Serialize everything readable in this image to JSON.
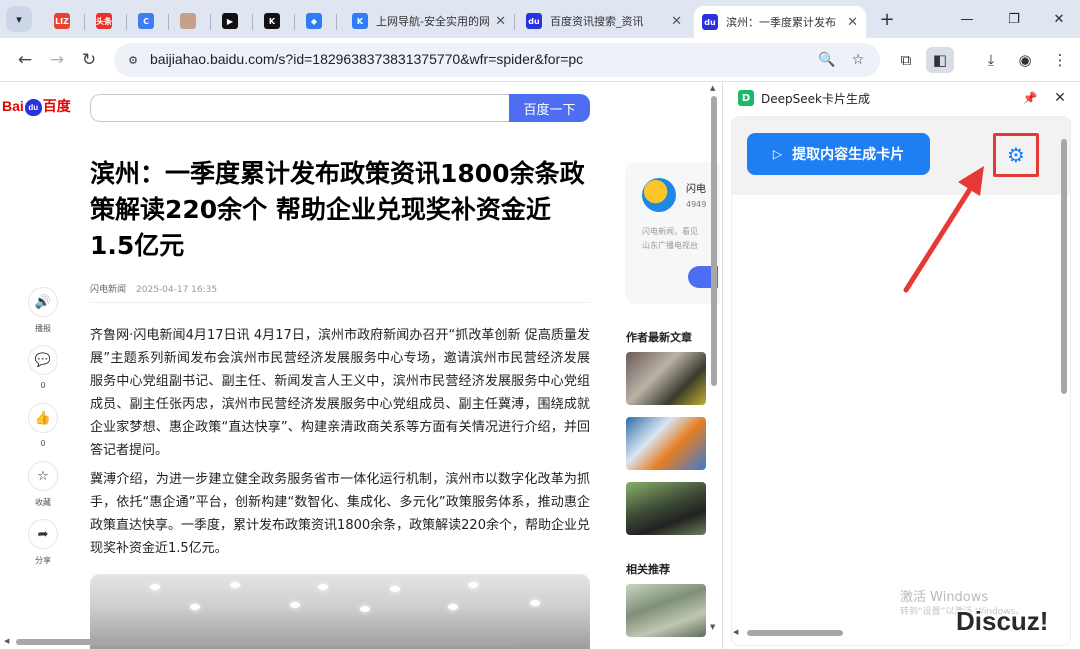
{
  "browser": {
    "tabs": [
      {
        "label": "",
        "favicon_text": "LIZ",
        "favicon_color": "#e94235"
      },
      {
        "label": "",
        "favicon_text": "头条",
        "favicon_color": "#e8322c"
      },
      {
        "label": "",
        "favicon_text": "C",
        "favicon_color": "#3d7cf4"
      },
      {
        "label": "",
        "favicon_text": "",
        "favicon_color": "#c7a08c"
      },
      {
        "label": "",
        "favicon_text": "▶",
        "favicon_color": "#111111"
      },
      {
        "label": "",
        "favicon_text": "K",
        "favicon_color": "#111111"
      },
      {
        "label": "",
        "favicon_text": "◆",
        "favicon_color": "#2f7df6"
      },
      {
        "label": "上网导航-安全实用的网",
        "favicon_text": "K",
        "favicon_color": "#2f7df6"
      },
      {
        "label": "百度资讯搜索_资讯",
        "favicon_text": "du",
        "favicon_color": "#2932e1"
      },
      {
        "label": "滨州：一季度累计发布",
        "favicon_text": "du",
        "favicon_color": "#2932e1"
      }
    ],
    "url": "baijiahao.baidu.com/s?id=1829638373831375770&wfr=spider&for=pc",
    "window_controls": {
      "minimize": "—",
      "restore": "❐",
      "close": "✕"
    }
  },
  "baidu": {
    "logo_left": "Bai",
    "logo_paw": "du",
    "logo_right": "百度",
    "search_button": "百度一下"
  },
  "article": {
    "title": "滨州：一季度累计发布政策资讯1800余条政策解读220余个 帮助企业兑现奖补资金近1.5亿元",
    "source": "闪电新闻",
    "date": "2025-04-17 16:35",
    "paragraphs": [
      "齐鲁网·闪电新闻4月17日讯 4月17日，滨州市政府新闻办召开“抓改革创新 促高质量发展”主题系列新闻发布会滨州市民营经济发展服务中心专场，邀请滨州市民营经济发展服务中心党组副书记、副主任、新闻发言人王义中，滨州市民营经济发展服务中心党组成员、副主任张丙忠，滨州市民营经济发展服务中心党组成员、副主任冀溥，围绕成就企业家梦想、惠企政策“直达快享”、构建亲清政商关系等方面有关情况进行介绍，并回答记者提问。",
      "冀溥介绍，为进一步建立健全政务服务省市一体化运行机制，滨州市以数字化改革为抓手，依托“惠企通”平台，创新构建“数智化、集成化、多元化”政策服务体系，推动惠企政策直达快享。一季度，累计发布政策资讯1800余条，政策解读220余个，帮助企业兑现奖补资金近1.5亿元。"
    ],
    "actions": [
      {
        "label": "播报",
        "icon": "speaker-icon",
        "glyph": "🔊"
      },
      {
        "label": "0",
        "icon": "comment-icon",
        "glyph": "💬"
      },
      {
        "label": "0",
        "icon": "thumbs-up-icon",
        "glyph": "👍"
      },
      {
        "label": "收藏",
        "icon": "star-icon",
        "glyph": "☆"
      },
      {
        "label": "分享",
        "icon": "share-icon",
        "glyph": "➦"
      }
    ]
  },
  "author_card": {
    "name": "闪电",
    "number": "4949",
    "desc_line1": "闪电新闻，看见",
    "desc_line2": "山东广播电视台"
  },
  "sidebar_sections": {
    "latest": "作者最新文章",
    "related": "相关推荐"
  },
  "extension_panel": {
    "title": "DeepSeek卡片生成",
    "logo_letter": "D",
    "pin_glyph": "📌",
    "close_glyph": "✕",
    "generate_button": "提取内容生成卡片",
    "generate_glyph": "▷",
    "settings_glyph": "⚙",
    "accent_color": "#1e7ff3",
    "highlight_color": "#e53935"
  },
  "watermarks": {
    "activate_line1": "激活 Windows",
    "activate_line2": "转到“设置”以激活 Windows。",
    "site": "Discuz!"
  }
}
